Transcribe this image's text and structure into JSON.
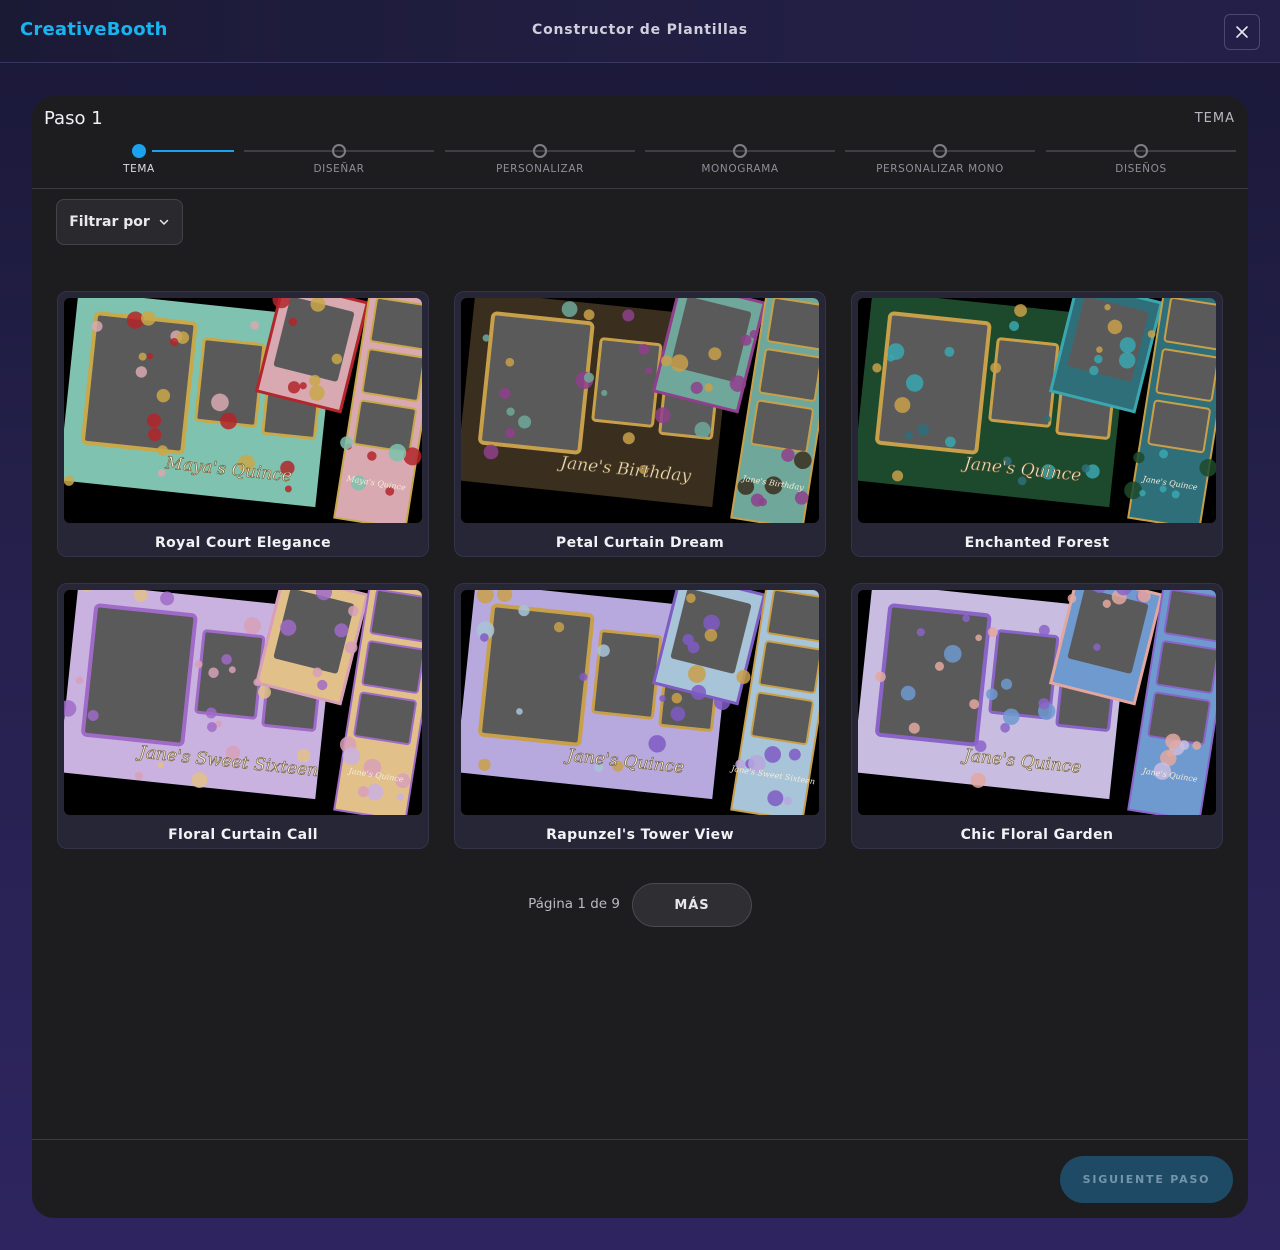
{
  "app": {
    "brand": "CreativeBooth",
    "title": "Constructor de Plantillas"
  },
  "step": {
    "title": "Paso 1",
    "name": "TEMA"
  },
  "stepper": {
    "steps": [
      {
        "label": "TEMA",
        "active": true
      },
      {
        "label": "DISEÑAR",
        "active": false
      },
      {
        "label": "PERSONALIZAR",
        "active": false
      },
      {
        "label": "MONOGRAMA",
        "active": false
      },
      {
        "label": "PERSONALIZAR MONO",
        "active": false
      },
      {
        "label": "DISEÑOS",
        "active": false
      }
    ]
  },
  "filter": {
    "label": "Filtrar por"
  },
  "templates": [
    {
      "name": "Royal Court Elegance",
      "overlay_text": "Maya's Quince",
      "strip_text": "Maya's Quince",
      "palette": [
        "#7fc2b0",
        "#c9a84a",
        "#b3262b",
        "#d8a9b0"
      ]
    },
    {
      "name": "Petal Curtain Dream",
      "overlay_text": "Jane's Birthday",
      "strip_text": "Jane's Birthday",
      "palette": [
        "#3a2e1e",
        "#c9a04a",
        "#8f3f8c",
        "#6fa89a"
      ]
    },
    {
      "name": "Enchanted Forest",
      "overlay_text": "Jane's Quince",
      "strip_text": "Jane's Quince",
      "palette": [
        "#1d4a2c",
        "#c9a04a",
        "#3aa7b0",
        "#2f6f7a"
      ]
    },
    {
      "name": "Floral Curtain Call",
      "overlay_text": "Jane's Sweet Sixteen",
      "strip_text": "Jane's Quince",
      "palette": [
        "#c9b2e0",
        "#a06bc8",
        "#d8a0b8",
        "#e2c08a"
      ]
    },
    {
      "name": "Rapunzel's Tower View",
      "overlay_text": "Jane's Quince",
      "strip_text": "Jane's Sweet Sixteen",
      "palette": [
        "#b7a8de",
        "#c9a04a",
        "#7f5bc4",
        "#a8c4d8"
      ]
    },
    {
      "name": "Chic Floral Garden",
      "overlay_text": "Jane's Quince",
      "strip_text": "Jane's Quince",
      "palette": [
        "#c8bde0",
        "#8a64c8",
        "#e2a8a0",
        "#6f9ad0"
      ]
    }
  ],
  "pagination": {
    "text": "Página 1 de 9",
    "more_label": "MÁS"
  },
  "footer": {
    "next_label": "SIGUIENTE PASO"
  },
  "colors": {
    "accent": "#1aa2ee",
    "brand": "#18b4f0",
    "panel": "#1d1d1f",
    "next_button": "#1f4a66"
  }
}
